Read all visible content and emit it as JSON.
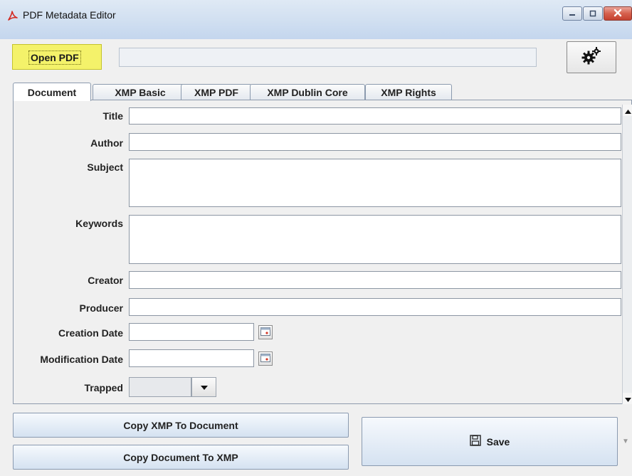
{
  "window": {
    "title": "PDF Metadata Editor",
    "app_icon": "pdf-icon",
    "controls": [
      "minimize-icon",
      "maximize-icon",
      "close-icon"
    ]
  },
  "toolbar": {
    "open_label": "Open PDF",
    "file_path_value": "",
    "settings_icon": "gears-icon",
    "open_highlight_color": "#f4f26a"
  },
  "tabs": [
    {
      "label": "Document",
      "active": true
    },
    {
      "label": "XMP Basic",
      "active": false
    },
    {
      "label": "XMP PDF",
      "active": false
    },
    {
      "label": "XMP Dublin Core",
      "active": false
    },
    {
      "label": "XMP Rights",
      "active": false
    }
  ],
  "fields": {
    "title": {
      "label": "Title",
      "value": ""
    },
    "author": {
      "label": "Author",
      "value": ""
    },
    "subject": {
      "label": "Subject",
      "value": ""
    },
    "keywords": {
      "label": "Keywords",
      "value": ""
    },
    "creator": {
      "label": "Creator",
      "value": ""
    },
    "producer": {
      "label": "Producer",
      "value": ""
    },
    "creation_date": {
      "label": "Creation Date",
      "value": "",
      "icon": "calendar-icon"
    },
    "modification_date": {
      "label": "Modification Date",
      "value": "",
      "icon": "calendar-icon"
    },
    "trapped": {
      "label": "Trapped",
      "value": ""
    }
  },
  "actions": {
    "copy_xmp_to_doc": "Copy XMP To Document",
    "copy_doc_to_xmp": "Copy Document To XMP",
    "save": "Save",
    "save_icon": "floppy-disk-icon",
    "save_menu_icon": "chevron-down-icon"
  }
}
